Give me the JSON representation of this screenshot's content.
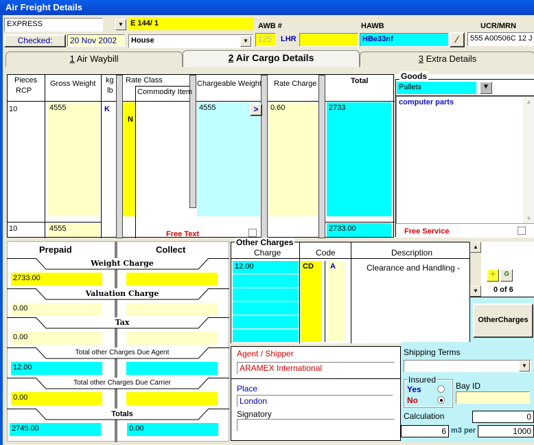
{
  "window": {
    "title": "Air Freight Details"
  },
  "header": {
    "service_type": "EXPRESS",
    "reference": "E 144/ 1",
    "checked_button": "Checked:",
    "checked_date": "20 Nov 2002",
    "awb_type": "House",
    "awb_label": "AWB #",
    "awb_prefix": "125",
    "awb_origin": "LHR",
    "awb_number": "",
    "hawb_label": "HAWB",
    "hawb_value": "HBe33nf",
    "ucr_label": "UCR/MRN",
    "ucr_value": "555 A00506C 12 J"
  },
  "tabs": [
    {
      "num": "1",
      "label": " Air Waybill",
      "active": false
    },
    {
      "num": "2",
      "label": " Air Cargo Details",
      "active": true
    },
    {
      "num": "3",
      "label": " Extra Details",
      "active": false
    }
  ],
  "cargo_table": {
    "headers": {
      "pieces": "Pieces",
      "rcp": "RCP",
      "gross_weight": "Gross Weight",
      "kg": "kg",
      "lb": "lb",
      "rate_class": "Rate Class",
      "commodity_item": "Commodity Item",
      "chargeable_weight": "Chargeable Weight",
      "rate_charge": "Rate Charge",
      "total": "Total"
    },
    "row": {
      "pieces": "10",
      "gross_weight": "4555",
      "unit": "K",
      "rate_class": "N",
      "commodity_item": "",
      "chargeable_weight": "4555",
      "rate_charge": "0.60",
      "total": "2733"
    },
    "totals": {
      "pieces": "10",
      "gross_weight": "4555",
      "total": "2733.00"
    },
    "free_text_label": "Free Text"
  },
  "goods": {
    "label": "Goods",
    "type": "Pallets",
    "description": "computer parts",
    "free_service_label": "Free Service"
  },
  "charges": {
    "prepaid_label": "Prepaid",
    "collect_label": "Collect",
    "sections": [
      {
        "label": "Weight Charge",
        "prepaid": "2733.00",
        "collect": ""
      },
      {
        "label": "Valuation Charge",
        "prepaid": "0.00",
        "collect": ""
      },
      {
        "label": "Tax",
        "prepaid": "0.00",
        "collect": ""
      },
      {
        "label": "Total other Charges Due Agent",
        "prepaid": "12.00",
        "collect": ""
      },
      {
        "label": "Total other Charges Due Carrier",
        "prepaid": "0.00",
        "collect": ""
      },
      {
        "label": "Totals",
        "prepaid": "2745.00",
        "collect": "0.00"
      }
    ]
  },
  "other_charges": {
    "label": "Other Charges",
    "headers": {
      "charge": "Charge",
      "code": "Code",
      "description": "Description"
    },
    "rows": [
      {
        "charge": "12.00",
        "code": "CD",
        "party": "A",
        "description": "Clearance and Handling -"
      }
    ],
    "counter": "0   of 6",
    "button": "OtherCharges"
  },
  "agent": {
    "label": "Agent / Shipper",
    "value": "ARAMEX International",
    "place_label": "Place",
    "place_value": "London",
    "signatory_label": "Signatory",
    "signatory_value": ""
  },
  "shipping": {
    "terms_label": "Shipping Terms",
    "terms_value": "",
    "insured_label": "Insured",
    "yes_label": "Yes",
    "no_label": "No",
    "insured": "No",
    "bay_id_label": "Bay ID",
    "bay_id_value": "",
    "calculation_label": "Calculation",
    "calculation_value": "0",
    "m3_value": "6",
    "m3_per_label": "m3 per",
    "per_value": "1000"
  }
}
